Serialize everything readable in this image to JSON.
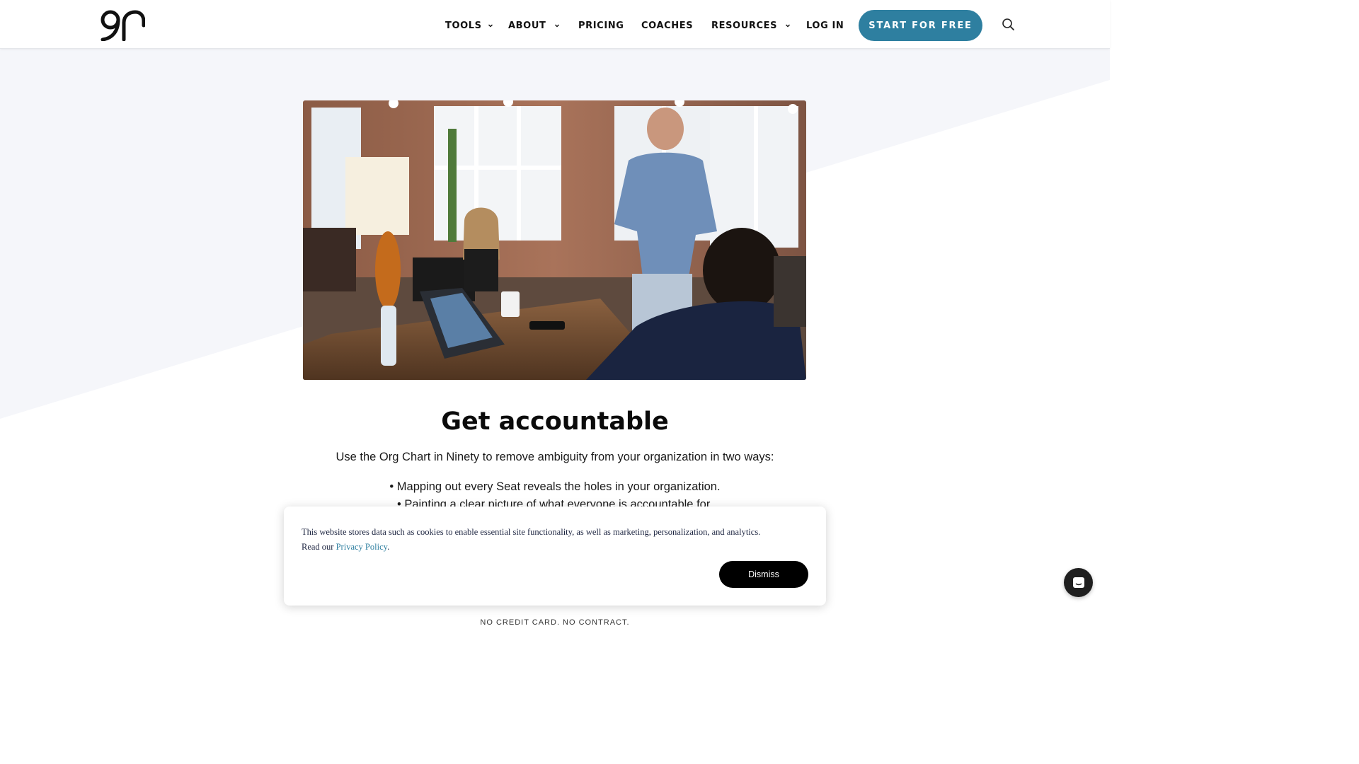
{
  "header": {
    "logo_alt": "90",
    "nav": [
      {
        "label": "TOOLS",
        "has_dropdown": true
      },
      {
        "label": "ABOUT",
        "has_dropdown": true
      },
      {
        "label": "PRICING",
        "has_dropdown": false
      },
      {
        "label": "COACHES",
        "has_dropdown": false
      },
      {
        "label": "RESOURCES",
        "has_dropdown": true
      },
      {
        "label": "LOG IN",
        "has_dropdown": false
      }
    ],
    "cta_label": "START FOR FREE",
    "search_icon": "search-icon"
  },
  "main": {
    "headline": "Get accountable",
    "intro": "Use the Org Chart in Ninety to remove ambiguity from your organization in two ways:",
    "bullets": [
      "• Mapping out every Seat reveals the holes in your organization.",
      "• Painting a clear picture of what everyone is accountable for."
    ],
    "fineprint": "NO CREDIT CARD. NO CONTRACT."
  },
  "cookie_banner": {
    "text": "This website stores data such as cookies to enable essential site functionality, as well as marketing, personalization, and analytics.",
    "read_our": "Read our",
    "policy_link": "Privacy Policy",
    "period": ".",
    "dismiss_label": "Dismiss"
  },
  "chat_widget": {
    "icon": "chat-icon"
  },
  "colors": {
    "accent": "#2e7fa0",
    "band": "#f5f6fa",
    "dark": "#000000"
  }
}
